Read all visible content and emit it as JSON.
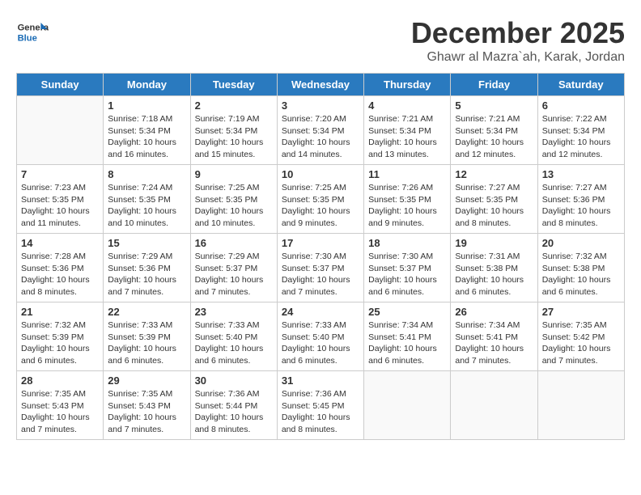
{
  "header": {
    "logo_general": "General",
    "logo_blue": "Blue",
    "month_title": "December 2025",
    "location": "Ghawr al Mazra`ah, Karak, Jordan"
  },
  "days_of_week": [
    "Sunday",
    "Monday",
    "Tuesday",
    "Wednesday",
    "Thursday",
    "Friday",
    "Saturday"
  ],
  "weeks": [
    [
      {
        "day": "",
        "info": ""
      },
      {
        "day": "1",
        "info": "Sunrise: 7:18 AM\nSunset: 5:34 PM\nDaylight: 10 hours\nand 16 minutes."
      },
      {
        "day": "2",
        "info": "Sunrise: 7:19 AM\nSunset: 5:34 PM\nDaylight: 10 hours\nand 15 minutes."
      },
      {
        "day": "3",
        "info": "Sunrise: 7:20 AM\nSunset: 5:34 PM\nDaylight: 10 hours\nand 14 minutes."
      },
      {
        "day": "4",
        "info": "Sunrise: 7:21 AM\nSunset: 5:34 PM\nDaylight: 10 hours\nand 13 minutes."
      },
      {
        "day": "5",
        "info": "Sunrise: 7:21 AM\nSunset: 5:34 PM\nDaylight: 10 hours\nand 12 minutes."
      },
      {
        "day": "6",
        "info": "Sunrise: 7:22 AM\nSunset: 5:34 PM\nDaylight: 10 hours\nand 12 minutes."
      }
    ],
    [
      {
        "day": "7",
        "info": "Sunrise: 7:23 AM\nSunset: 5:35 PM\nDaylight: 10 hours\nand 11 minutes."
      },
      {
        "day": "8",
        "info": "Sunrise: 7:24 AM\nSunset: 5:35 PM\nDaylight: 10 hours\nand 10 minutes."
      },
      {
        "day": "9",
        "info": "Sunrise: 7:25 AM\nSunset: 5:35 PM\nDaylight: 10 hours\nand 10 minutes."
      },
      {
        "day": "10",
        "info": "Sunrise: 7:25 AM\nSunset: 5:35 PM\nDaylight: 10 hours\nand 9 minutes."
      },
      {
        "day": "11",
        "info": "Sunrise: 7:26 AM\nSunset: 5:35 PM\nDaylight: 10 hours\nand 9 minutes."
      },
      {
        "day": "12",
        "info": "Sunrise: 7:27 AM\nSunset: 5:35 PM\nDaylight: 10 hours\nand 8 minutes."
      },
      {
        "day": "13",
        "info": "Sunrise: 7:27 AM\nSunset: 5:36 PM\nDaylight: 10 hours\nand 8 minutes."
      }
    ],
    [
      {
        "day": "14",
        "info": "Sunrise: 7:28 AM\nSunset: 5:36 PM\nDaylight: 10 hours\nand 8 minutes."
      },
      {
        "day": "15",
        "info": "Sunrise: 7:29 AM\nSunset: 5:36 PM\nDaylight: 10 hours\nand 7 minutes."
      },
      {
        "day": "16",
        "info": "Sunrise: 7:29 AM\nSunset: 5:37 PM\nDaylight: 10 hours\nand 7 minutes."
      },
      {
        "day": "17",
        "info": "Sunrise: 7:30 AM\nSunset: 5:37 PM\nDaylight: 10 hours\nand 7 minutes."
      },
      {
        "day": "18",
        "info": "Sunrise: 7:30 AM\nSunset: 5:37 PM\nDaylight: 10 hours\nand 6 minutes."
      },
      {
        "day": "19",
        "info": "Sunrise: 7:31 AM\nSunset: 5:38 PM\nDaylight: 10 hours\nand 6 minutes."
      },
      {
        "day": "20",
        "info": "Sunrise: 7:32 AM\nSunset: 5:38 PM\nDaylight: 10 hours\nand 6 minutes."
      }
    ],
    [
      {
        "day": "21",
        "info": "Sunrise: 7:32 AM\nSunset: 5:39 PM\nDaylight: 10 hours\nand 6 minutes."
      },
      {
        "day": "22",
        "info": "Sunrise: 7:33 AM\nSunset: 5:39 PM\nDaylight: 10 hours\nand 6 minutes."
      },
      {
        "day": "23",
        "info": "Sunrise: 7:33 AM\nSunset: 5:40 PM\nDaylight: 10 hours\nand 6 minutes."
      },
      {
        "day": "24",
        "info": "Sunrise: 7:33 AM\nSunset: 5:40 PM\nDaylight: 10 hours\nand 6 minutes."
      },
      {
        "day": "25",
        "info": "Sunrise: 7:34 AM\nSunset: 5:41 PM\nDaylight: 10 hours\nand 6 minutes."
      },
      {
        "day": "26",
        "info": "Sunrise: 7:34 AM\nSunset: 5:41 PM\nDaylight: 10 hours\nand 7 minutes."
      },
      {
        "day": "27",
        "info": "Sunrise: 7:35 AM\nSunset: 5:42 PM\nDaylight: 10 hours\nand 7 minutes."
      }
    ],
    [
      {
        "day": "28",
        "info": "Sunrise: 7:35 AM\nSunset: 5:43 PM\nDaylight: 10 hours\nand 7 minutes."
      },
      {
        "day": "29",
        "info": "Sunrise: 7:35 AM\nSunset: 5:43 PM\nDaylight: 10 hours\nand 7 minutes."
      },
      {
        "day": "30",
        "info": "Sunrise: 7:36 AM\nSunset: 5:44 PM\nDaylight: 10 hours\nand 8 minutes."
      },
      {
        "day": "31",
        "info": "Sunrise: 7:36 AM\nSunset: 5:45 PM\nDaylight: 10 hours\nand 8 minutes."
      },
      {
        "day": "",
        "info": ""
      },
      {
        "day": "",
        "info": ""
      },
      {
        "day": "",
        "info": ""
      }
    ]
  ]
}
